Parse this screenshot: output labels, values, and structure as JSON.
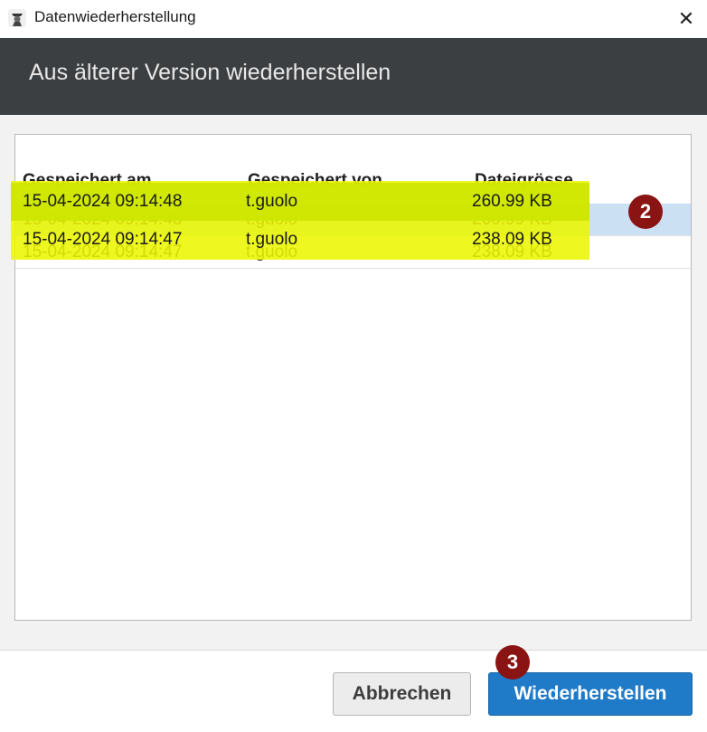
{
  "window": {
    "title": "Datenwiederherstellung",
    "close_glyph": "✕",
    "app_icon": "app-logo-icon"
  },
  "header": {
    "title": "Aus älterer Version wiederherstellen"
  },
  "table": {
    "columns": [
      "Gespeichert am",
      "Gespeichert von",
      "Dateigrösse"
    ],
    "rows": [
      {
        "saved_at": "15-04-2024 09:14:48",
        "saved_by": "t.guolo",
        "size": "260.99 KB",
        "selected": true
      },
      {
        "saved_at": "15-04-2024 09:14:47",
        "saved_by": "t.guolo",
        "size": "238.09 KB",
        "selected": false
      }
    ]
  },
  "annotations": {
    "step_2": "2",
    "step_3": "3"
  },
  "buttons": {
    "cancel": "Abbrechen",
    "restore": "Wiederherstellen"
  },
  "colors": {
    "header_band": "#3c3f42",
    "selected_row": "#cce0f4",
    "highlight": "#ecf600",
    "primary_button": "#1f7ac8",
    "badge": "#8a1414"
  }
}
